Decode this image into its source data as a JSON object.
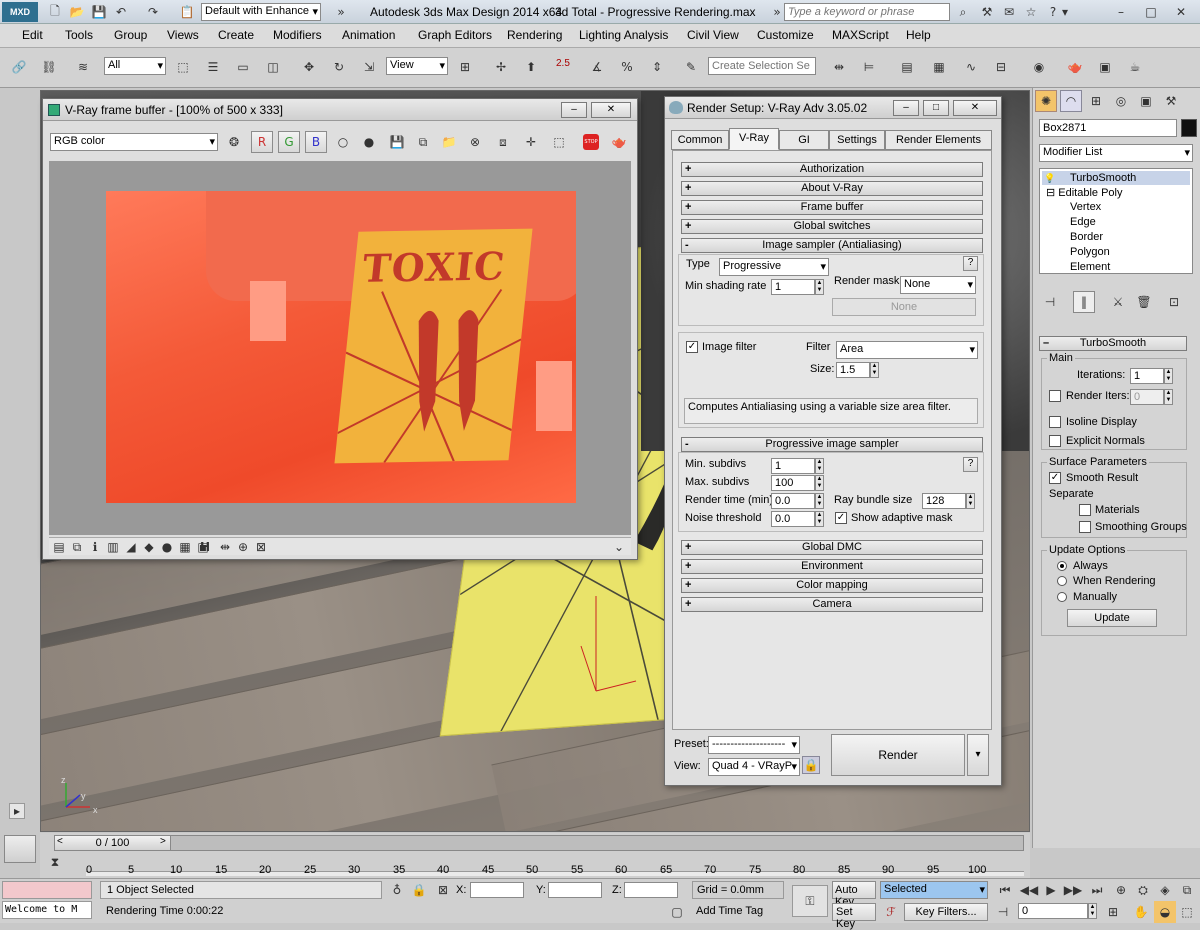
{
  "app": {
    "title": "Autodesk 3ds Max Design 2014 x64",
    "file": "3d Total - Progressive Rendering.max",
    "workspace": "Default with Enhance",
    "search_placeholder": "Type a keyword or phrase",
    "logo": "MXD"
  },
  "menu": [
    "Edit",
    "Tools",
    "Group",
    "Views",
    "Create",
    "Modifiers",
    "Animation",
    "Graph Editors",
    "Rendering",
    "Lighting Analysis",
    "Civil View",
    "Customize",
    "MAXScript",
    "Help"
  ],
  "toolbar": {
    "filter_value": "All",
    "refcoord_value": "View",
    "selection_set_placeholder": "Create Selection Se",
    "snap_label": "2.5"
  },
  "framebuffer": {
    "title": "V-Ray frame buffer - [100% of 500 x 333]",
    "channel": "RGB color",
    "btn_r": "R",
    "btn_g": "G",
    "btn_b": "B",
    "poster_text": "TOXIC",
    "stop_label": "STOP",
    "status_h": "H"
  },
  "render_setup": {
    "title": "Render Setup: V-Ray Adv 3.05.02",
    "tabs": [
      "Common",
      "V-Ray",
      "GI",
      "Settings",
      "Render Elements"
    ],
    "active_tab": "V-Ray",
    "rollouts_top": [
      {
        "sign": "+",
        "label": "Authorization"
      },
      {
        "sign": "+",
        "label": "About V-Ray"
      },
      {
        "sign": "+",
        "label": "Frame buffer"
      },
      {
        "sign": "+",
        "label": "Global switches"
      },
      {
        "sign": "-",
        "label": "Image sampler (Antialiasing)"
      }
    ],
    "sampler": {
      "type_label": "Type",
      "type_value": "Progressive",
      "min_shading_label": "Min shading rate",
      "min_shading_value": "1",
      "render_mask_label": "Render mask",
      "render_mask_value": "None",
      "none_button": "None",
      "help": "?"
    },
    "filter": {
      "checkbox_label": "Image filter",
      "checked": "✓",
      "filter_label": "Filter",
      "filter_value": "Area",
      "size_label": "Size:",
      "size_value": "1.5",
      "description": "Computes Antialiasing using a variable size area filter."
    },
    "progressive_rollout": {
      "sign": "-",
      "label": "Progressive image sampler"
    },
    "progressive": {
      "min_subdivs_label": "Min. subdivs",
      "min_subdivs": "1",
      "max_subdivs_label": "Max. subdivs",
      "max_subdivs": "100",
      "render_time_label": "Render time (min)",
      "render_time": "0.0",
      "noise_label": "Noise threshold",
      "noise": "0.0",
      "ray_bundle_label": "Ray bundle size",
      "ray_bundle": "128",
      "adaptive_label": "Show adaptive mask",
      "adaptive_checked": "✓",
      "help": "?"
    },
    "rollouts_bottom": [
      {
        "sign": "+",
        "label": "Global DMC"
      },
      {
        "sign": "+",
        "label": "Environment"
      },
      {
        "sign": "+",
        "label": "Color mapping"
      },
      {
        "sign": "+",
        "label": "Camera"
      }
    ],
    "preset_label": "Preset:",
    "preset_value": "--------------------",
    "view_label": "View:",
    "view_value": "Quad 4 - VRayP",
    "render_button": "Render"
  },
  "command_panel": {
    "object_name": "Box2871",
    "modifier_list": "Modifier List",
    "stack": [
      {
        "label": "TurboSmooth",
        "level": 0
      },
      {
        "label": "Editable Poly",
        "level": 0
      },
      {
        "label": "Vertex",
        "level": 1
      },
      {
        "label": "Edge",
        "level": 1
      },
      {
        "label": "Border",
        "level": 1
      },
      {
        "label": "Polygon",
        "level": 1
      },
      {
        "label": "Element",
        "level": 1
      }
    ],
    "rollout_title": "TurboSmooth",
    "main_group": "Main",
    "iterations_label": "Iterations:",
    "iterations": "1",
    "render_iters_label": "Render Iters:",
    "render_iters": "0",
    "isoline": "Isoline Display",
    "explicit_normals": "Explicit Normals",
    "surface_group": "Surface Parameters",
    "smooth_result": "Smooth Result",
    "separate": "Separate",
    "materials": "Materials",
    "smoothing_groups": "Smoothing Groups",
    "update_group": "Update Options",
    "always": "Always",
    "when_rendering": "When Rendering",
    "manually": "Manually",
    "update_button": "Update"
  },
  "timeline": {
    "frame_display": "0 / 100",
    "ticks": [
      "0",
      "5",
      "10",
      "15",
      "20",
      "25",
      "30",
      "35",
      "40",
      "45",
      "50",
      "55",
      "60",
      "65",
      "70",
      "75",
      "80",
      "85",
      "90",
      "95",
      "100"
    ]
  },
  "status": {
    "listener": "Welcome to M",
    "selection": "1 Object Selected",
    "render_time": "Rendering Time  0:00:22",
    "x_label": "X:",
    "y_label": "Y:",
    "z_label": "Z:",
    "grid": "Grid = 0.0mm",
    "add_time_tag": "Add Time Tag",
    "auto_key": "Auto Key",
    "set_key": "Set Key",
    "selected_value": "Selected",
    "key_filters": "Key Filters...",
    "frame_value": "0"
  },
  "viewport_axis": {
    "z": "z",
    "y": "y",
    "x": "x"
  }
}
